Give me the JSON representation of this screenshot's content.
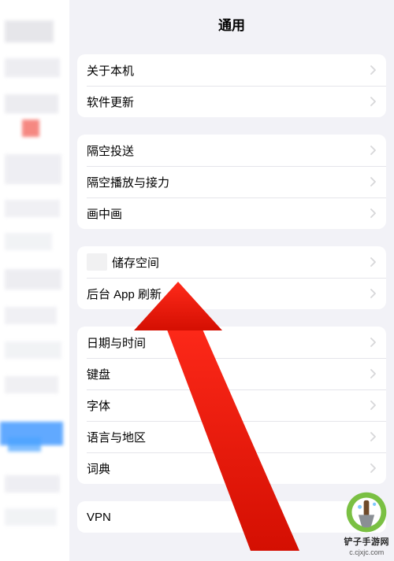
{
  "header": {
    "title": "通用"
  },
  "groups": [
    {
      "rows": [
        {
          "name": "about-device",
          "label": "关于本机"
        },
        {
          "name": "software-update",
          "label": "软件更新"
        }
      ]
    },
    {
      "rows": [
        {
          "name": "airdrop",
          "label": "隔空投送"
        },
        {
          "name": "airplay-handoff",
          "label": "隔空播放与接力"
        },
        {
          "name": "picture-in-picture",
          "label": "画中画"
        }
      ]
    },
    {
      "rows": [
        {
          "name": "storage",
          "label": "储存空间",
          "obscured_prefix": true
        },
        {
          "name": "background-app-refresh",
          "label": "后台 App 刷新"
        }
      ]
    },
    {
      "rows": [
        {
          "name": "date-time",
          "label": "日期与时间"
        },
        {
          "name": "keyboard",
          "label": "键盘"
        },
        {
          "name": "fonts",
          "label": "字体"
        },
        {
          "name": "language-region",
          "label": "语言与地区"
        },
        {
          "name": "dictionary",
          "label": "词典"
        }
      ]
    },
    {
      "rows": [
        {
          "name": "vpn",
          "label": "VPN"
        }
      ]
    }
  ],
  "annotation": {
    "target_label": "储存空间"
  },
  "watermark": {
    "brand": "铲子手游网",
    "url": "c.cjxjc.com"
  }
}
